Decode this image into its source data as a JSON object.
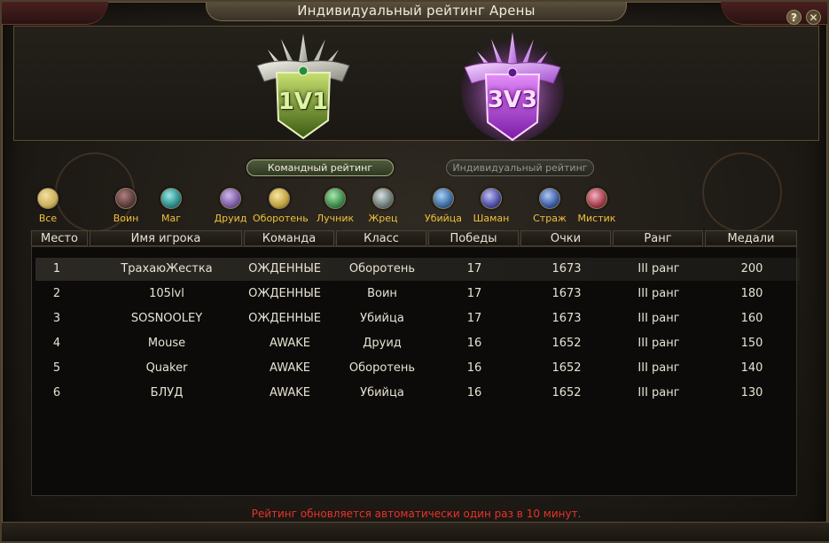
{
  "window": {
    "title": "Индивидуальный рейтинг Арены",
    "help_label": "?",
    "close_label": "✕"
  },
  "modes": [
    {
      "label": "1V1",
      "color": "#9ac24a"
    },
    {
      "label": "3V3",
      "color": "#c05ae0"
    }
  ],
  "tabs": {
    "team_label": "Командный рейтинг",
    "individual_label": "Индивидуальный рейтинг"
  },
  "classes": [
    {
      "label": "Все",
      "icon": "smiley-icon",
      "color": "#c9b05a"
    },
    {
      "label": "Воин",
      "icon": "warrior-icon",
      "color": "#5a3a3a"
    },
    {
      "label": "Маг",
      "icon": "mage-icon",
      "color": "#2a8a8a"
    },
    {
      "label": "Друид",
      "icon": "druid-icon",
      "color": "#7a5aa0"
    },
    {
      "label": "Оборотень",
      "icon": "werewolf-icon",
      "color": "#c0a040"
    },
    {
      "label": "Лучник",
      "icon": "archer-icon",
      "color": "#3a8a4a"
    },
    {
      "label": "Жрец",
      "icon": "priest-icon",
      "color": "#6a7a7a"
    },
    {
      "label": "Убийца",
      "icon": "assassin-icon",
      "color": "#3a6aa0"
    },
    {
      "label": "Шаман",
      "icon": "shaman-icon",
      "color": "#4a4aa0"
    },
    {
      "label": "Страж",
      "icon": "guardian-icon",
      "color": "#3a5aa0"
    },
    {
      "label": "Мистик",
      "icon": "mystic-icon",
      "color": "#a03a4a"
    }
  ],
  "table": {
    "headers": [
      "Место",
      "Имя игрока",
      "Команда",
      "Класс",
      "Победы",
      "Очки",
      "Ранг",
      "Медали"
    ],
    "rows": [
      [
        "1",
        "ТрахаюЖестка",
        "ОЖДЕННЫЕ",
        "Оборотень",
        "17",
        "1673",
        "III ранг",
        "200"
      ],
      [
        "2",
        "105lvl",
        "ОЖДЕННЫЕ",
        "Воин",
        "17",
        "1673",
        "III ранг",
        "180"
      ],
      [
        "3",
        "SOSNOOLEY",
        "ОЖДЕННЫЕ",
        "Убийца",
        "17",
        "1673",
        "III ранг",
        "160"
      ],
      [
        "4",
        "Mouse",
        "AWAKE",
        "Друид",
        "16",
        "1652",
        "III ранг",
        "150"
      ],
      [
        "5",
        "Quaker",
        "AWAKE",
        "Оборотень",
        "16",
        "1652",
        "III ранг",
        "140"
      ],
      [
        "6",
        "БЛУД",
        "AWAKE",
        "Убийца",
        "16",
        "1652",
        "III ранг",
        "130"
      ]
    ]
  },
  "footer_note": "Рейтинг обновляется автоматически один раз в 10 минут."
}
